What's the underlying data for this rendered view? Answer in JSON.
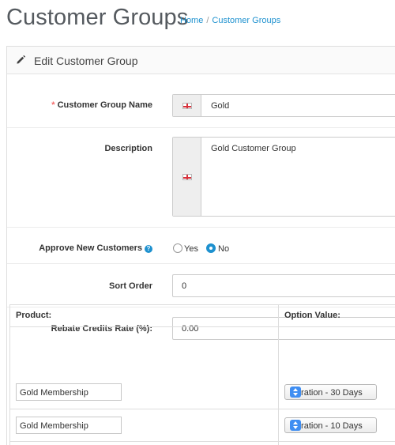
{
  "page": {
    "title": "Customer Groups",
    "breadcrumb": {
      "home": "Home",
      "separator": "/",
      "current": "Customer Groups"
    }
  },
  "panel": {
    "heading": "Edit Customer Group",
    "heading_icon": "pencil-icon"
  },
  "form": {
    "group_name": {
      "required_mark": "*",
      "label": "Customer Group Name",
      "value": "Gold",
      "language_icon": "uk-flag-icon"
    },
    "description": {
      "label": "Description",
      "value": "Gold Customer Group",
      "language_icon": "uk-flag-icon"
    },
    "approve": {
      "label": "Approve New Customers",
      "help_icon": "?",
      "options": [
        {
          "label": "Yes",
          "checked": false
        },
        {
          "label": "No",
          "checked": true
        }
      ]
    },
    "sort_order": {
      "label": "Sort Order",
      "value": "0"
    },
    "rebate": {
      "label": "Rebate Credits Rate (%):",
      "value": "0.00"
    }
  },
  "table": {
    "headers": {
      "product": "Product:",
      "option_value": "Option Value:"
    },
    "rows": [
      {
        "product": "Gold Membership",
        "option": "Duration - 30 Days"
      },
      {
        "product": "Gold Membership",
        "option": "Duration - 10 Days"
      }
    ]
  },
  "colors": {
    "accent": "#1e91cf",
    "required": "#f56b6b",
    "select_stepper": "#3f8ef2"
  }
}
